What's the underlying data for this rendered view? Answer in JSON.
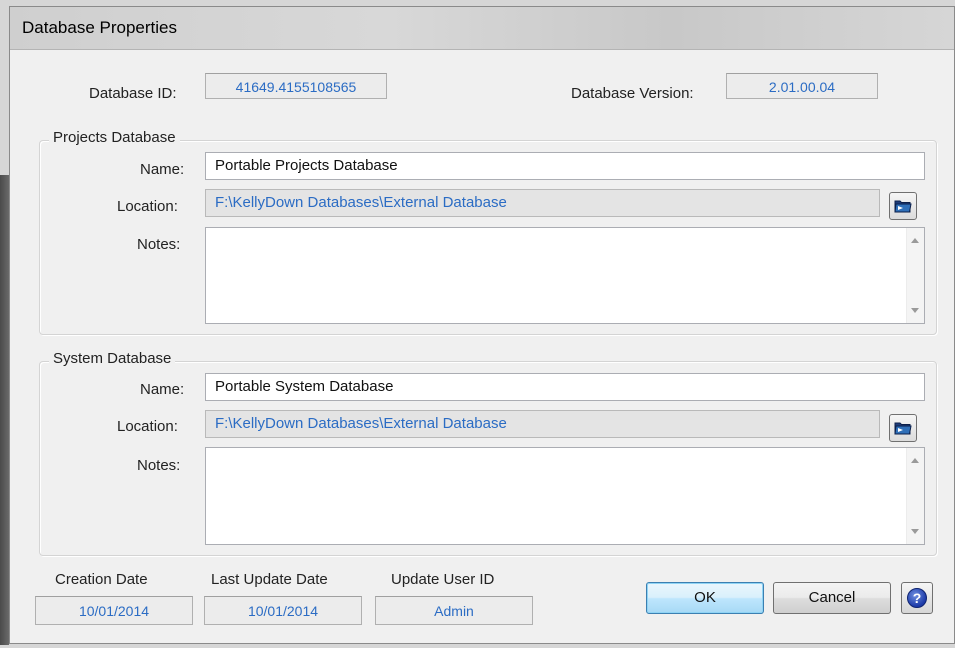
{
  "window": {
    "title": "Database Properties"
  },
  "header": {
    "database_id_label": "Database ID:",
    "database_id_value": "41649.4155108565",
    "database_version_label": "Database Version:",
    "database_version_value": "2.01.00.04"
  },
  "projects": {
    "group_label": "Projects Database",
    "name_label": "Name:",
    "name_value": "Portable Projects Database",
    "location_label": "Location:",
    "location_value": "F:\\KellyDown Databases\\External Database",
    "notes_label": "Notes:",
    "notes_value": ""
  },
  "system": {
    "group_label": "System Database",
    "name_label": "Name:",
    "name_value": "Portable System Database",
    "location_label": "Location:",
    "location_value": "F:\\KellyDown Databases\\External Database",
    "notes_label": "Notes:",
    "notes_value": ""
  },
  "footer": {
    "creation_date_label": "Creation Date",
    "creation_date_value": "10/01/2014",
    "last_update_label": "Last Update Date",
    "last_update_value": "10/01/2014",
    "update_user_label": "Update User ID",
    "update_user_value": "Admin"
  },
  "buttons": {
    "ok": "OK",
    "cancel": "Cancel",
    "help": "?"
  },
  "colors": {
    "value_text": "#2b6cc4",
    "dialog_bg": "#f0f0f0"
  },
  "icons": {
    "browse": "folder-icon",
    "help": "help-icon"
  }
}
